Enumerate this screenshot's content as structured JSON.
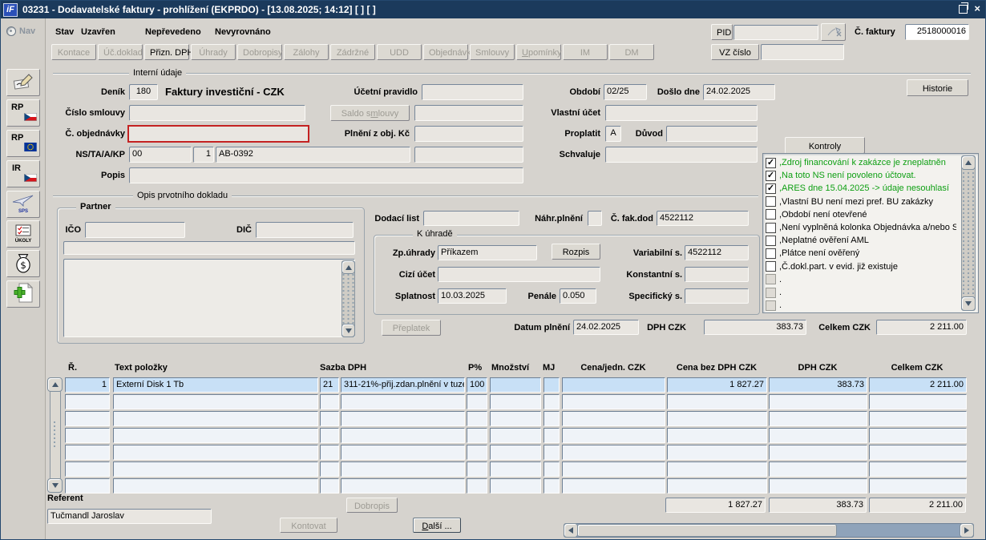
{
  "window": {
    "title": "03231 - Dodavatelské faktury - prohlížení (EKPRDO) - [13.08.2025; 14:12]  [ ]  [ ]",
    "icon_text": "iF"
  },
  "sidebar": {
    "nav": "Nav",
    "icons": [
      {
        "name": "signature",
        "label": ""
      },
      {
        "name": "rp-cz",
        "label": "RP"
      },
      {
        "name": "rp-eu",
        "label": "RP"
      },
      {
        "name": "ir-cz",
        "label": "IR"
      },
      {
        "name": "sps",
        "label": "SPS"
      },
      {
        "name": "ukoly",
        "label": "ÚKOLY"
      },
      {
        "name": "money",
        "label": "$"
      },
      {
        "name": "new-doc",
        "label": ""
      }
    ]
  },
  "status": {
    "stav": "Stav",
    "flags": [
      "Uzavřen",
      "Nepřevedeno",
      "Nevyrovnáno"
    ],
    "pid": "PID",
    "pid_value": "",
    "c_faktury": "Č. faktury",
    "c_faktury_value": "2518000016",
    "vz": "VZ číslo",
    "vz_value": ""
  },
  "tabs": [
    {
      "label": "Kontace",
      "enabled": false
    },
    {
      "label": "Úč.doklad",
      "enabled": false
    },
    {
      "label": "Přizn. DPH",
      "enabled": true
    },
    {
      "label": "Úhrady",
      "enabled": false
    },
    {
      "label": "Dobropisy",
      "enabled": false
    },
    {
      "label": "Zálohy",
      "enabled": false
    },
    {
      "label": "Zádržné",
      "enabled": false
    },
    {
      "label": "UDD",
      "enabled": false
    },
    {
      "label": "Objednávky",
      "enabled": false
    },
    {
      "label": "Smlouvy",
      "enabled": false
    },
    {
      "label": "Upomínky",
      "enabled": false,
      "accel": 0
    },
    {
      "label": "IM",
      "enabled": false
    },
    {
      "label": "DM",
      "enabled": false
    }
  ],
  "interni": {
    "section": "Interní údaje",
    "denik": "Deník",
    "denik_value": "180",
    "denik_name": "Faktury investiční - CZK",
    "ucetni_pravidlo": "Účetní pravidlo",
    "ucetni_pravidlo_value": "",
    "obdobi": "Období",
    "obdobi_value": "02/25",
    "doslo": "Došlo dne",
    "doslo_value": "24.02.2025",
    "historie": "Historie",
    "cislo_smlouvy": "Číslo smlouvy",
    "cislo_smlouvy_value": "",
    "saldo": "Saldo smlouvy",
    "saldo_accel": 7,
    "saldo_value": "",
    "vlastni_ucet": "Vlastní účet",
    "vlastni_ucet_value": "",
    "c_objednavky": "Č. objednávky",
    "c_objednavky_value": "",
    "plneni": "Plnění z obj. Kč",
    "plneni_value": "",
    "proplatit": "Proplatit",
    "proplatit_value": "A",
    "duvod": "Důvod",
    "duvod_value": "",
    "ns": "NS/TA/A/KP",
    "ns1": "00",
    "ns2": "1",
    "ns3": "AB-0392",
    "ns4": "",
    "schvaluje": "Schvaluje",
    "schvaluje_value": "",
    "popis": "Popis",
    "popis_value": ""
  },
  "kontroly": {
    "button": "Kontroly",
    "items": [
      {
        "checked": true,
        "green": true,
        "label": ",Zdroj financování k zakázce je zneplatněn"
      },
      {
        "checked": true,
        "green": true,
        "label": ",Na toto NS není povoleno účtovat."
      },
      {
        "checked": true,
        "green": true,
        "label": ",ARES dne 15.04.2025 -> údaje nesouhlasí"
      },
      {
        "checked": false,
        "green": false,
        "label": ",Vlastní BU není mezi pref. BU zakázky"
      },
      {
        "checked": false,
        "green": false,
        "label": ",Období není otevřené"
      },
      {
        "checked": false,
        "green": false,
        "label": ",Není vyplněná kolonka Objednávka a/nebo Smlouva"
      },
      {
        "checked": false,
        "green": false,
        "label": ",Neplatné ověření AML"
      },
      {
        "checked": false,
        "green": false,
        "label": ",Plátce není ověřený"
      },
      {
        "checked": false,
        "green": false,
        "label": ",Č.dokl.part. v evid. již existuje"
      },
      {
        "checked": false,
        "disabled": true,
        "label": "."
      },
      {
        "checked": false,
        "disabled": true,
        "label": "."
      },
      {
        "checked": false,
        "disabled": true,
        "label": "."
      }
    ]
  },
  "opis": {
    "section": "Opis prvotního dokladu",
    "partner": "Partner",
    "ico": "IČO",
    "ico_value": "",
    "dic": "DIČ",
    "dic_value": "",
    "nazev_value": "",
    "dodaci": "Dodací list",
    "dodaci_value": "",
    "nahr": "Náhr.plnění",
    "nahr_value": "",
    "c_fakdod": "Č. fak.dod",
    "c_fakdod_value": "4522112"
  },
  "uhrada": {
    "section": "K úhradě",
    "zp": "Zp.úhrady",
    "zp_value": "Příkazem",
    "rozpis": "Rozpis",
    "variabilni": "Variabilní s.",
    "variabilni_value": "4522112",
    "cizi": "Cizí účet",
    "cizi_value": "",
    "konstantni": "Konstantní s.",
    "konstantni_value": "",
    "splatnost": "Splatnost",
    "splatnost_value": "10.03.2025",
    "penale": "Penále",
    "penale_value": "0.050",
    "specificky": "Specifický s.",
    "specificky_value": "",
    "preplatek": "Přeplatek",
    "datum_plneni": "Datum plnění",
    "datum_plneni_value": "24.02.2025",
    "dph": "DPH CZK",
    "dph_value": "383.73",
    "celkem": "Celkem CZK",
    "celkem_value": "2 211.00"
  },
  "table": {
    "headers": [
      "Ř.",
      "Text položky",
      "Sazba DPH",
      "P%",
      "Množství",
      "MJ",
      "Cena/jedn. CZK",
      "Cena bez DPH CZK",
      "DPH CZK",
      "Celkem CZK"
    ],
    "row_count": 7,
    "rows": [
      {
        "r": "1",
        "text": "Externí Disk 1 Tb",
        "kod": "21",
        "popis": "311-21%-přij.zdan.plnění v tuze",
        "p": "100",
        "mn": "",
        "mj": "",
        "cj": "",
        "cb": "1 827.27",
        "dph": "383.73",
        "celkem": "2 211.00"
      }
    ],
    "totals": [
      "1 827.27",
      "383.73",
      "2 211.00"
    ]
  },
  "footer": {
    "referent": "Referent",
    "referent_value": "Tučmandl Jaroslav",
    "dobropis": "Dobropis",
    "kontovat": "Kontovat",
    "dalsi": "Další ...",
    "dalsi_accel": 0
  }
}
